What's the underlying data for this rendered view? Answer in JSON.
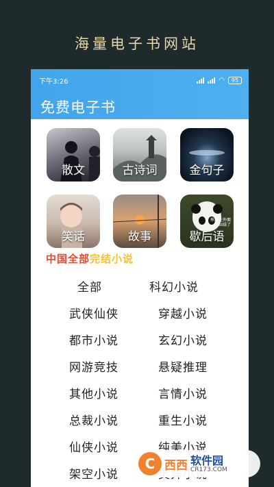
{
  "banner": {
    "title": "海量电子书网站"
  },
  "status_bar": {
    "time": "下午3:26",
    "wifi_icon": "wifi-icon",
    "battery": "95"
  },
  "app": {
    "title": "免费电子书"
  },
  "tiles": [
    {
      "label": "散文"
    },
    {
      "label": "古诗词"
    },
    {
      "label": "金句子"
    },
    {
      "label": "笑话"
    },
    {
      "label": "故事"
    },
    {
      "label": "歇后语"
    }
  ],
  "tile_image_caption": {
    "line1": "熊猫在外面",
    "line2": "好纠结了"
  },
  "section": {
    "title_part1": "中国全部",
    "title_part2": "完结小说"
  },
  "categories": [
    "全部",
    "科幻小说",
    "武侠仙侠",
    "穿越小说",
    "都市小说",
    "玄幻小说",
    "网游竞技",
    "悬疑推理",
    "其他小说",
    "言情小说",
    "总裁小说",
    "重生小说",
    "仙侠小说",
    "纯美小说",
    "架空小说",
    "灵异小说"
  ],
  "watermark": {
    "logo": "C",
    "brand": "西西",
    "site": "软件园",
    "url": "CR173.COM"
  },
  "colors": {
    "appbar": "#42a4ea",
    "banner_text": "#e8d7a8",
    "section_red": "#e24a32",
    "section_yellow": "#f1c232"
  }
}
